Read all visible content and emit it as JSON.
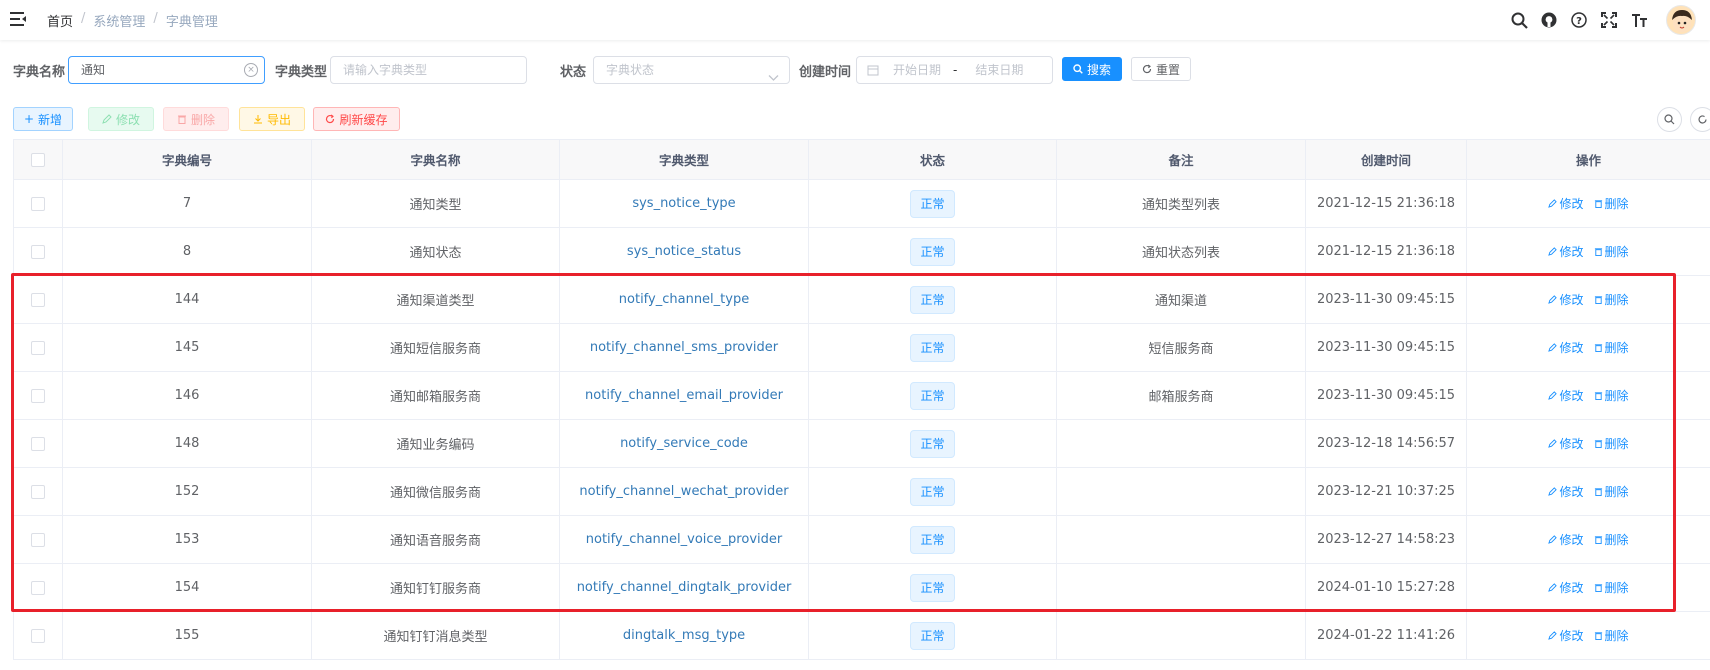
{
  "breadcrumb": [
    "首页",
    "系统管理",
    "字典管理"
  ],
  "search": {
    "dict_name_label": "字典名称",
    "dict_name_value": "通知",
    "dict_type_label": "字典类型",
    "dict_type_placeholder": "请输入字典类型",
    "status_label": "状态",
    "status_placeholder": "字典状态",
    "created_label": "创建时间",
    "start_placeholder": "开始日期",
    "range_sep": "-",
    "end_placeholder": "结束日期",
    "search_btn": "搜索",
    "reset_btn": "重置"
  },
  "toolbar": {
    "add": "新增",
    "edit": "修改",
    "delete": "删除",
    "export": "导出",
    "refresh_cache": "刷新缓存"
  },
  "table": {
    "headers": [
      "字典编号",
      "字典名称",
      "字典类型",
      "状态",
      "备注",
      "创建时间",
      "操作"
    ],
    "edit_label": "修改",
    "delete_label": "删除",
    "rows": [
      {
        "id": "7",
        "name": "通知类型",
        "type": "sys_notice_type",
        "status": "正常",
        "remark": "通知类型列表",
        "created": "2021-12-15 21:36:18"
      },
      {
        "id": "8",
        "name": "通知状态",
        "type": "sys_notice_status",
        "status": "正常",
        "remark": "通知状态列表",
        "created": "2021-12-15 21:36:18"
      },
      {
        "id": "144",
        "name": "通知渠道类型",
        "type": "notify_channel_type",
        "status": "正常",
        "remark": "通知渠道",
        "created": "2023-11-30 09:45:15"
      },
      {
        "id": "145",
        "name": "通知短信服务商",
        "type": "notify_channel_sms_provider",
        "status": "正常",
        "remark": "短信服务商",
        "created": "2023-11-30 09:45:15"
      },
      {
        "id": "146",
        "name": "通知邮箱服务商",
        "type": "notify_channel_email_provider",
        "status": "正常",
        "remark": "邮箱服务商",
        "created": "2023-11-30 09:45:15"
      },
      {
        "id": "148",
        "name": "通知业务编码",
        "type": "notify_service_code",
        "status": "正常",
        "remark": "",
        "created": "2023-12-18 14:56:57"
      },
      {
        "id": "152",
        "name": "通知微信服务商",
        "type": "notify_channel_wechat_provider",
        "status": "正常",
        "remark": "",
        "created": "2023-12-21 10:37:25"
      },
      {
        "id": "153",
        "name": "通知语音服务商",
        "type": "notify_channel_voice_provider",
        "status": "正常",
        "remark": "",
        "created": "2023-12-27 14:58:23"
      },
      {
        "id": "154",
        "name": "通知钉钉服务商",
        "type": "notify_channel_dingtalk_provider",
        "status": "正常",
        "remark": "",
        "created": "2024-01-10 15:27:28"
      },
      {
        "id": "155",
        "name": "通知钉钉消息类型",
        "type": "dingtalk_msg_type",
        "status": "正常",
        "remark": "",
        "created": "2024-01-22 11:41:26"
      }
    ]
  },
  "colors": {
    "primary": "#1890ff",
    "highlight_box": "#e8202a",
    "link": "#337ab7"
  }
}
